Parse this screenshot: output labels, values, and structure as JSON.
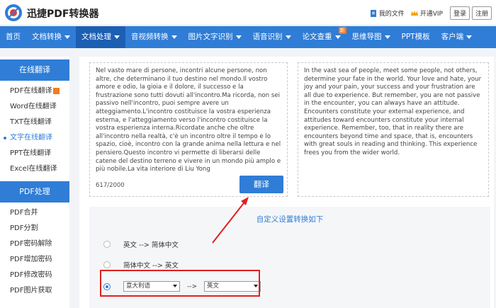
{
  "brand": {
    "name": "迅捷PDF转换器"
  },
  "topbar": {
    "my_files": "我的文件",
    "vip": "开通VIP",
    "login": "登录",
    "register": "注册"
  },
  "nav": {
    "items": [
      {
        "label": "首页",
        "caret": false
      },
      {
        "label": "文档转换",
        "caret": true
      },
      {
        "label": "文档处理",
        "caret": true,
        "active": true
      },
      {
        "label": "音视频转换",
        "caret": true
      },
      {
        "label": "图片文字识别",
        "caret": true
      },
      {
        "label": "语音识别",
        "caret": true
      },
      {
        "label": "论文查重",
        "caret": true,
        "badge": "新"
      },
      {
        "label": "思维导图",
        "caret": true
      },
      {
        "label": "PPT模板",
        "caret": false
      },
      {
        "label": "客户端",
        "caret": true
      }
    ]
  },
  "sidebar": {
    "section1": "在线翻译",
    "section1_items": [
      "PDF在线翻译",
      "Word在线翻译",
      "TXT在线翻译",
      "文字在线翻译",
      "PPT在线翻译",
      "Excel在线翻译"
    ],
    "section2": "PDF处理",
    "section2_items": [
      "PDF合并",
      "PDF分割",
      "PDF密码解除",
      "PDF增加密码",
      "PDF修改密码",
      "PDF图片获取"
    ]
  },
  "main": {
    "source_text": "Nel vasto mare di persone, incontri alcune persone, non altre, che determinano il tuo destino nel mondo.Il vostro amore e odio, la gioia e il dolore, il successo e la frustrazione sono tutti dovuti all'incontro.Ma ricorda, non sei passivo nell'incontro, puoi sempre avere un atteggiamento.L'incontro costituisce la vostra esperienza esterna, e l'atteggiamento verso l'incontro costituisce la vostra esperienza interna.Ricordate anche che oltre all'incontro nella realtà, c'è un incontro oltre il tempo e lo spazio, cioè, incontro con la grande anima nella lettura e nel pensiero.Questo incontro vi permette di liberarsi delle catene del destino terreno e vivere in un mondo più amplo e più nobile.La vita interiore di Liu Yong",
    "counter": "617/2000",
    "translate_btn": "翻译",
    "result_text": "In the vast sea of people, meet some people, not others, determine your fate in the world. Your love and hate, your joy and your pain, your success and your frustration are all due to experience. But remember, you are not passive in the encounter, you can always have an attitude. Encounters constitute your external experience, and attitudes toward encounters constitute your internal experience. Remember, too, that in reality there are encounters beyond time and space, that is, encounters with great souls in reading and thinking. This experience frees you from the wider world."
  },
  "custom": {
    "title": "自定义设置转换如下",
    "option1": "英文 --> 简体中文",
    "option2": "简体中文 --> 英文",
    "from_lang": "意大利语",
    "arrow": "-->",
    "to_lang": "英文"
  },
  "colors": {
    "accent": "#2f7dd6",
    "highlight": "#e02020",
    "badge": "#f27c1f"
  }
}
